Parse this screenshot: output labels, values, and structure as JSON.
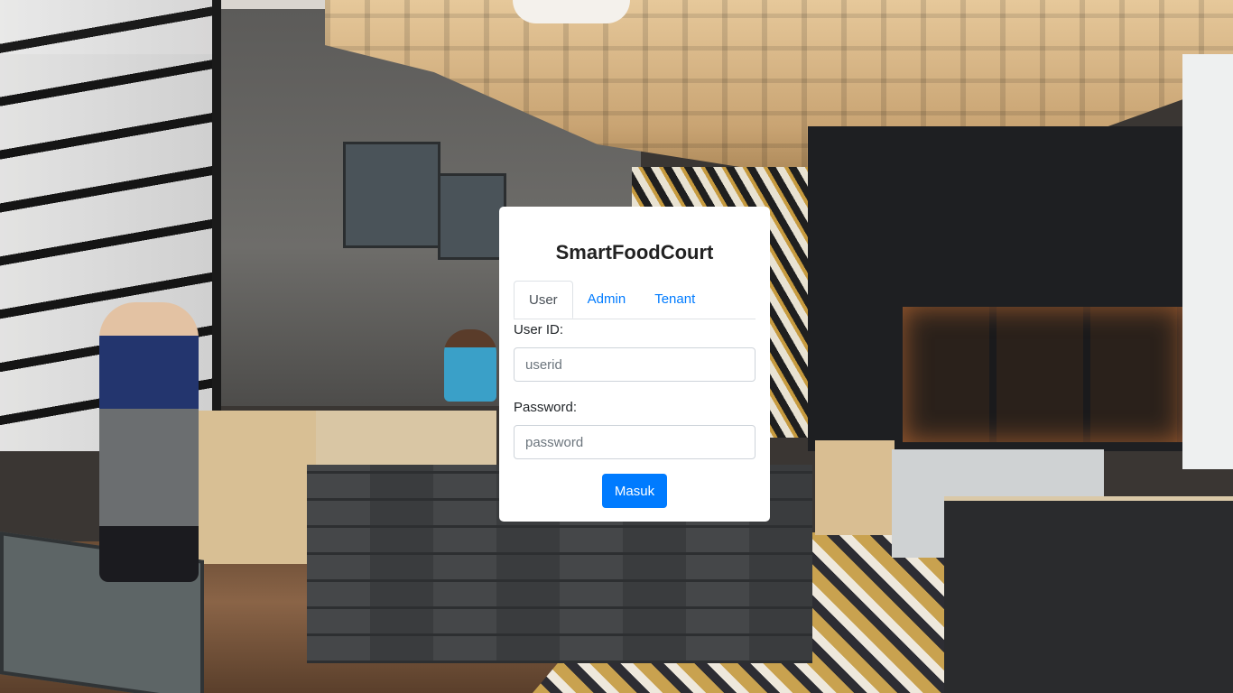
{
  "app": {
    "title": "SmartFoodCourt"
  },
  "tabs": [
    {
      "label": "User",
      "active": true
    },
    {
      "label": "Admin",
      "active": false
    },
    {
      "label": "Tenant",
      "active": false
    }
  ],
  "form": {
    "user_id_label": "User ID:",
    "user_id_placeholder": "userid",
    "user_id_value": "",
    "password_label": "Password:",
    "password_placeholder": "password",
    "password_value": "",
    "submit_label": "Masuk"
  },
  "colors": {
    "accent": "#007bff",
    "card_background": "#ffffff",
    "text": "#212529"
  }
}
